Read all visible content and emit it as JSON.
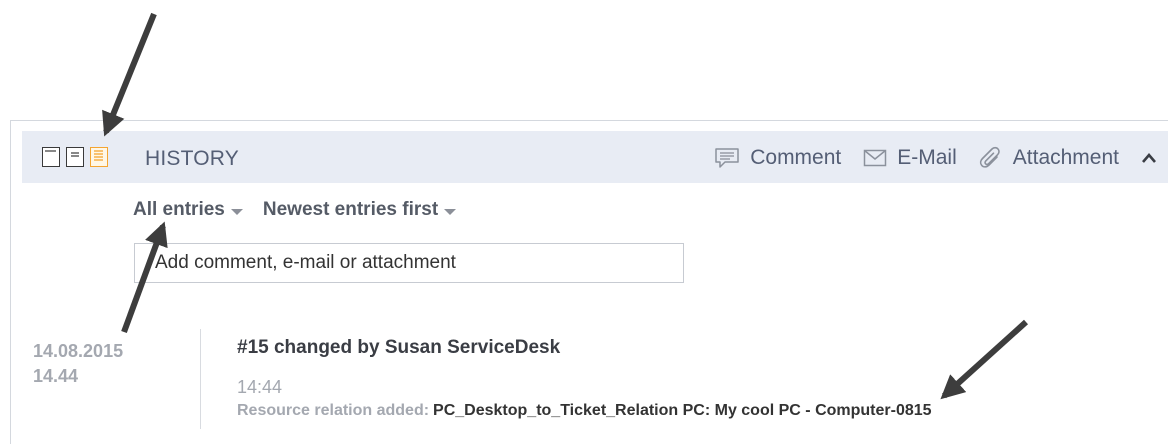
{
  "header": {
    "title": "HISTORY",
    "layout_icons": [
      "single-column-layout-icon",
      "two-column-layout-icon",
      "history-layout-icon"
    ],
    "active_layout_color": "#f4a531",
    "actions": {
      "comment": "Comment",
      "email": "E-Mail",
      "attachment": "Attachment"
    }
  },
  "filters": {
    "entries": "All entries",
    "order": "Newest entries first"
  },
  "input": {
    "placeholder": "Add comment, e-mail or attachment"
  },
  "entry": {
    "date": "14.08.2015",
    "time_short": "14.44",
    "title": "#15 changed by Susan ServiceDesk",
    "time": "14:44",
    "detail_label": "Resource relation added:",
    "detail_value": "PC_Desktop_to_Ticket_Relation PC: My cool PC - Computer-0815"
  },
  "colors": {
    "header_bg": "#e8ecf4",
    "accent": "#f4a531",
    "muted_text": "#a4a8b0",
    "arrow": "#3d3d3d"
  }
}
